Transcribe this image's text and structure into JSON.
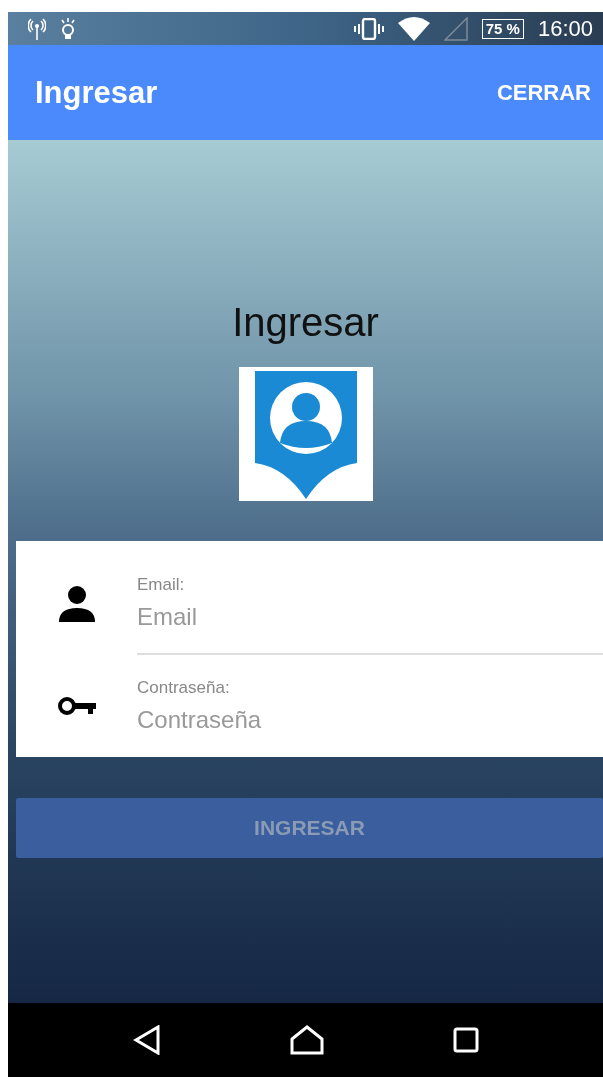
{
  "status_bar": {
    "battery": "75 %",
    "time": "16:00"
  },
  "app_bar": {
    "title": "Ingresar",
    "action": "CERRAR"
  },
  "heading": "Ingresar",
  "form": {
    "fields": [
      {
        "kind": "email",
        "label": "Email:",
        "placeholder": "Email"
      },
      {
        "kind": "password",
        "label": "Contraseña:",
        "placeholder": "Contraseña"
      }
    ]
  },
  "submit": {
    "label": "INGRESAR",
    "disabled": true
  }
}
